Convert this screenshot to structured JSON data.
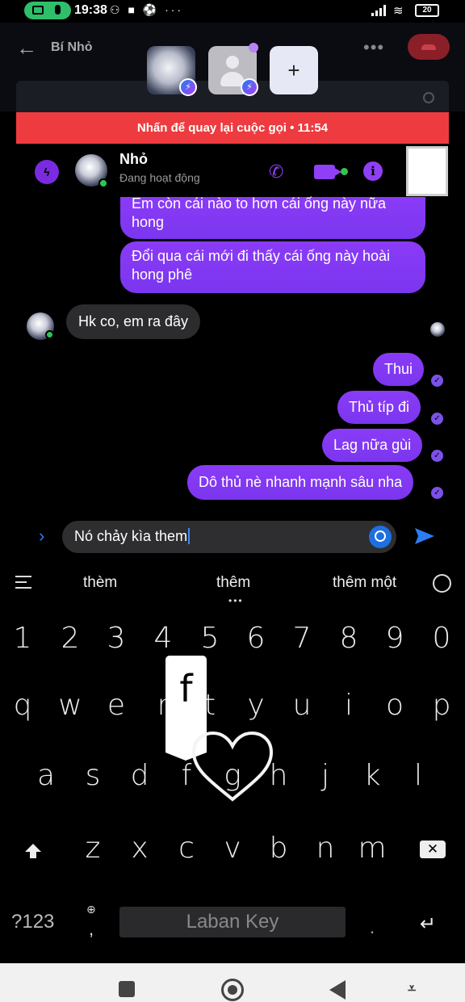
{
  "status_bar": {
    "time": "19:38",
    "notification_icons": "⚇ ■ ⚽ ···",
    "battery": "20",
    "wifi_glyph": "≋"
  },
  "call": {
    "back_glyph": "←",
    "title": "Bí Nhỏ",
    "add_glyph": "+",
    "more_glyph": "•••",
    "return_banner": "Nhấn để quay lại cuộc gọi • 11:54"
  },
  "conversation": {
    "name": "Nhỏ",
    "status": "Đang hoạt động",
    "info_glyph": "i",
    "phone_glyph": "✆"
  },
  "messages": [
    {
      "dir": "out",
      "text": "Em còn cái nào to hơn cái ống này nữa hong"
    },
    {
      "dir": "out",
      "text": "Đổi qua cái mới đi thấy cái ống này hoài hong phê"
    },
    {
      "dir": "in",
      "text": "Hk co, em ra đây"
    },
    {
      "dir": "out",
      "text": "Thui"
    },
    {
      "dir": "out",
      "text": "Thủ típ đi"
    },
    {
      "dir": "out",
      "text": "Lag nữa gùi"
    },
    {
      "dir": "out",
      "text": "Dô thủ nè nhanh mạnh sâu nha"
    }
  ],
  "composer": {
    "expand_glyph": "›",
    "value": "Nó chảy kìa them"
  },
  "keyboard": {
    "suggestions": [
      "thèm",
      "thêm",
      "thêm một"
    ],
    "suggestion_more": "•••",
    "numbers": [
      "1",
      "2",
      "3",
      "4",
      "5",
      "6",
      "7",
      "8",
      "9",
      "0"
    ],
    "row1": [
      "q",
      "w",
      "e",
      "r",
      "t",
      "y",
      "u",
      "i",
      "o",
      "p"
    ],
    "row2": [
      "a",
      "s",
      "d",
      "f",
      "g",
      "h",
      "j",
      "k",
      "l"
    ],
    "row3": [
      "z",
      "x",
      "c",
      "v",
      "b",
      "n",
      "m"
    ],
    "popup_key": "f",
    "symbols_label": "?123",
    "globe_glyph": "⊕",
    "comma_label": ",",
    "space_label": "Laban Key",
    "period_label": ".",
    "enter_glyph": "↵",
    "backspace_glyph": "✕"
  },
  "navbar": {
    "down_glyph": "⩡"
  },
  "colors": {
    "accent_purple": "#8a3bf7",
    "banner_red": "#ee3b3f",
    "online_green": "#31c453",
    "messenger_blue": "#1d7cf2"
  }
}
